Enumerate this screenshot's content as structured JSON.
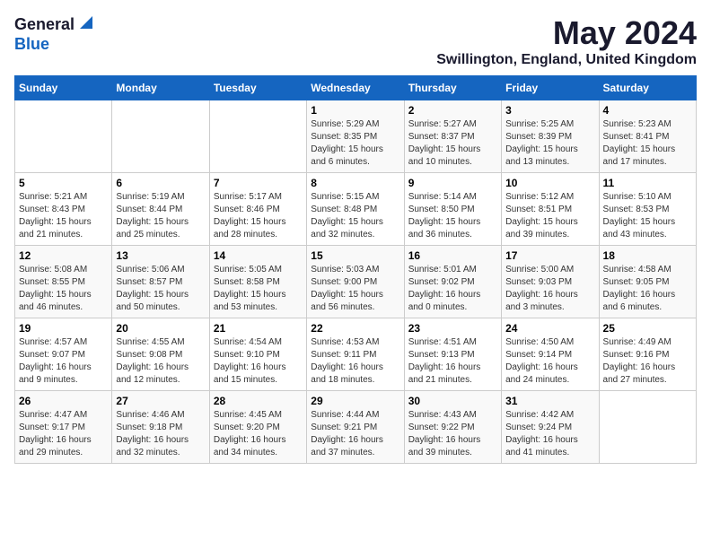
{
  "logo": {
    "general": "General",
    "blue": "Blue"
  },
  "title": "May 2024",
  "location": "Swillington, England, United Kingdom",
  "days_of_week": [
    "Sunday",
    "Monday",
    "Tuesday",
    "Wednesday",
    "Thursday",
    "Friday",
    "Saturday"
  ],
  "weeks": [
    [
      {
        "day": "",
        "info": ""
      },
      {
        "day": "",
        "info": ""
      },
      {
        "day": "",
        "info": ""
      },
      {
        "day": "1",
        "info": "Sunrise: 5:29 AM\nSunset: 8:35 PM\nDaylight: 15 hours\nand 6 minutes."
      },
      {
        "day": "2",
        "info": "Sunrise: 5:27 AM\nSunset: 8:37 PM\nDaylight: 15 hours\nand 10 minutes."
      },
      {
        "day": "3",
        "info": "Sunrise: 5:25 AM\nSunset: 8:39 PM\nDaylight: 15 hours\nand 13 minutes."
      },
      {
        "day": "4",
        "info": "Sunrise: 5:23 AM\nSunset: 8:41 PM\nDaylight: 15 hours\nand 17 minutes."
      }
    ],
    [
      {
        "day": "5",
        "info": "Sunrise: 5:21 AM\nSunset: 8:43 PM\nDaylight: 15 hours\nand 21 minutes."
      },
      {
        "day": "6",
        "info": "Sunrise: 5:19 AM\nSunset: 8:44 PM\nDaylight: 15 hours\nand 25 minutes."
      },
      {
        "day": "7",
        "info": "Sunrise: 5:17 AM\nSunset: 8:46 PM\nDaylight: 15 hours\nand 28 minutes."
      },
      {
        "day": "8",
        "info": "Sunrise: 5:15 AM\nSunset: 8:48 PM\nDaylight: 15 hours\nand 32 minutes."
      },
      {
        "day": "9",
        "info": "Sunrise: 5:14 AM\nSunset: 8:50 PM\nDaylight: 15 hours\nand 36 minutes."
      },
      {
        "day": "10",
        "info": "Sunrise: 5:12 AM\nSunset: 8:51 PM\nDaylight: 15 hours\nand 39 minutes."
      },
      {
        "day": "11",
        "info": "Sunrise: 5:10 AM\nSunset: 8:53 PM\nDaylight: 15 hours\nand 43 minutes."
      }
    ],
    [
      {
        "day": "12",
        "info": "Sunrise: 5:08 AM\nSunset: 8:55 PM\nDaylight: 15 hours\nand 46 minutes."
      },
      {
        "day": "13",
        "info": "Sunrise: 5:06 AM\nSunset: 8:57 PM\nDaylight: 15 hours\nand 50 minutes."
      },
      {
        "day": "14",
        "info": "Sunrise: 5:05 AM\nSunset: 8:58 PM\nDaylight: 15 hours\nand 53 minutes."
      },
      {
        "day": "15",
        "info": "Sunrise: 5:03 AM\nSunset: 9:00 PM\nDaylight: 15 hours\nand 56 minutes."
      },
      {
        "day": "16",
        "info": "Sunrise: 5:01 AM\nSunset: 9:02 PM\nDaylight: 16 hours\nand 0 minutes."
      },
      {
        "day": "17",
        "info": "Sunrise: 5:00 AM\nSunset: 9:03 PM\nDaylight: 16 hours\nand 3 minutes."
      },
      {
        "day": "18",
        "info": "Sunrise: 4:58 AM\nSunset: 9:05 PM\nDaylight: 16 hours\nand 6 minutes."
      }
    ],
    [
      {
        "day": "19",
        "info": "Sunrise: 4:57 AM\nSunset: 9:07 PM\nDaylight: 16 hours\nand 9 minutes."
      },
      {
        "day": "20",
        "info": "Sunrise: 4:55 AM\nSunset: 9:08 PM\nDaylight: 16 hours\nand 12 minutes."
      },
      {
        "day": "21",
        "info": "Sunrise: 4:54 AM\nSunset: 9:10 PM\nDaylight: 16 hours\nand 15 minutes."
      },
      {
        "day": "22",
        "info": "Sunrise: 4:53 AM\nSunset: 9:11 PM\nDaylight: 16 hours\nand 18 minutes."
      },
      {
        "day": "23",
        "info": "Sunrise: 4:51 AM\nSunset: 9:13 PM\nDaylight: 16 hours\nand 21 minutes."
      },
      {
        "day": "24",
        "info": "Sunrise: 4:50 AM\nSunset: 9:14 PM\nDaylight: 16 hours\nand 24 minutes."
      },
      {
        "day": "25",
        "info": "Sunrise: 4:49 AM\nSunset: 9:16 PM\nDaylight: 16 hours\nand 27 minutes."
      }
    ],
    [
      {
        "day": "26",
        "info": "Sunrise: 4:47 AM\nSunset: 9:17 PM\nDaylight: 16 hours\nand 29 minutes."
      },
      {
        "day": "27",
        "info": "Sunrise: 4:46 AM\nSunset: 9:18 PM\nDaylight: 16 hours\nand 32 minutes."
      },
      {
        "day": "28",
        "info": "Sunrise: 4:45 AM\nSunset: 9:20 PM\nDaylight: 16 hours\nand 34 minutes."
      },
      {
        "day": "29",
        "info": "Sunrise: 4:44 AM\nSunset: 9:21 PM\nDaylight: 16 hours\nand 37 minutes."
      },
      {
        "day": "30",
        "info": "Sunrise: 4:43 AM\nSunset: 9:22 PM\nDaylight: 16 hours\nand 39 minutes."
      },
      {
        "day": "31",
        "info": "Sunrise: 4:42 AM\nSunset: 9:24 PM\nDaylight: 16 hours\nand 41 minutes."
      },
      {
        "day": "",
        "info": ""
      }
    ]
  ]
}
